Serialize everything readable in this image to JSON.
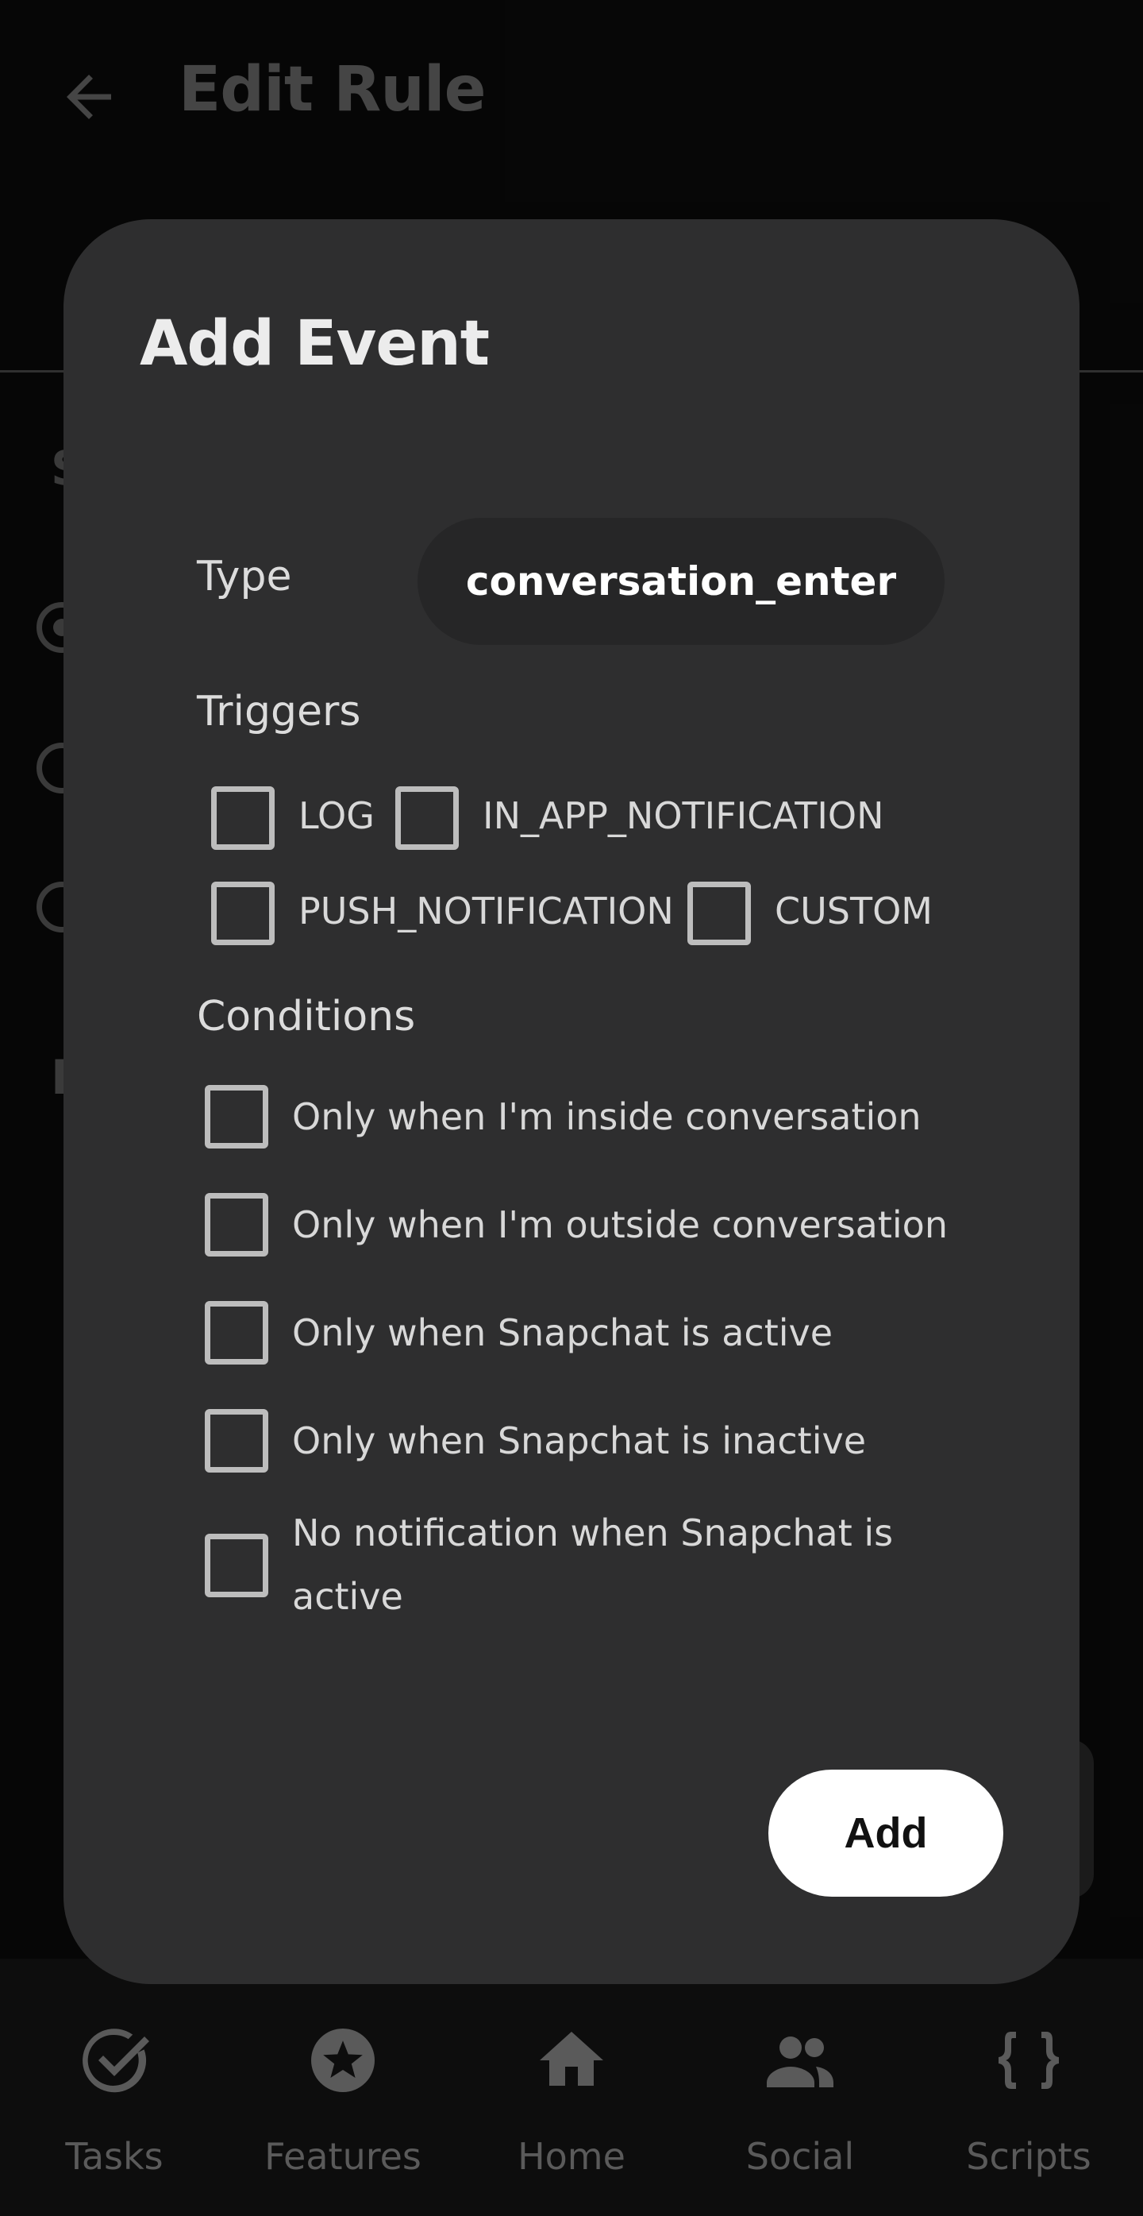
{
  "appbar": {
    "title": "Edit Rule",
    "back_icon": "arrow-back-icon"
  },
  "background": {
    "fragment_a": "S",
    "fragment_b": "E"
  },
  "dialog": {
    "title": "Add Event",
    "type_label": "Type",
    "type_value": "conversation_enter",
    "triggers_label": "Triggers",
    "triggers": [
      {
        "label": "LOG",
        "checked": false
      },
      {
        "label": "IN_APP_NOTIFICATION",
        "checked": false
      },
      {
        "label": "PUSH_NOTIFICATION",
        "checked": false
      },
      {
        "label": "CUSTOM",
        "checked": false
      }
    ],
    "conditions_label": "Conditions",
    "conditions": [
      {
        "label": "Only when I'm inside conversation",
        "checked": false
      },
      {
        "label": "Only when I'm outside conversation",
        "checked": false
      },
      {
        "label": "Only when Snapchat is active",
        "checked": false
      },
      {
        "label": "Only when Snapchat is inactive",
        "checked": false
      },
      {
        "label": "No notification when Snapchat is active",
        "checked": false
      }
    ],
    "add_label": "Add"
  },
  "bottom_nav": [
    {
      "label": "Tasks",
      "icon": "task-check-icon"
    },
    {
      "label": "Features",
      "icon": "star-icon"
    },
    {
      "label": "Home",
      "icon": "home-icon"
    },
    {
      "label": "Social",
      "icon": "people-icon"
    },
    {
      "label": "Scripts",
      "icon": "code-braces-icon"
    }
  ],
  "colors": {
    "dialog_bg": "#2e2e2f",
    "screen_bg": "#0a0a0a",
    "button_bg": "#ffffff"
  }
}
